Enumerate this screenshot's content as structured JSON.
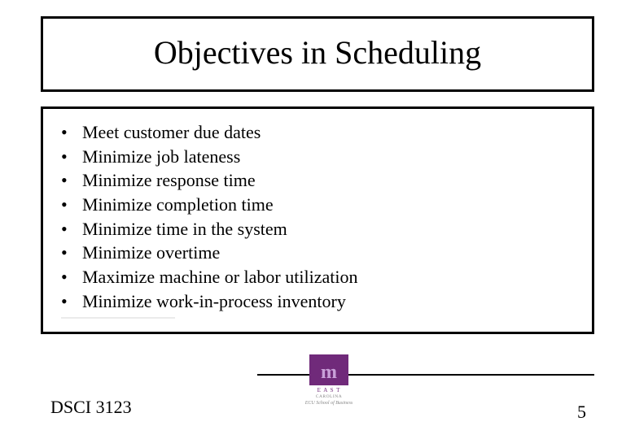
{
  "title": "Objectives in Scheduling",
  "bullets": [
    "Meet customer due dates",
    "Minimize job lateness",
    "Minimize response time",
    "Minimize completion time",
    "Minimize time in the system",
    "Minimize overtime",
    "Maximize machine or labor utilization",
    "Minimize work-in-process inventory"
  ],
  "footer": {
    "course_code": "DSCI 3123",
    "page_number": "5",
    "logo": {
      "letter": "m",
      "line1": "E A S T",
      "line2": "CAROLINA",
      "line3": "ECU School of Business"
    }
  }
}
